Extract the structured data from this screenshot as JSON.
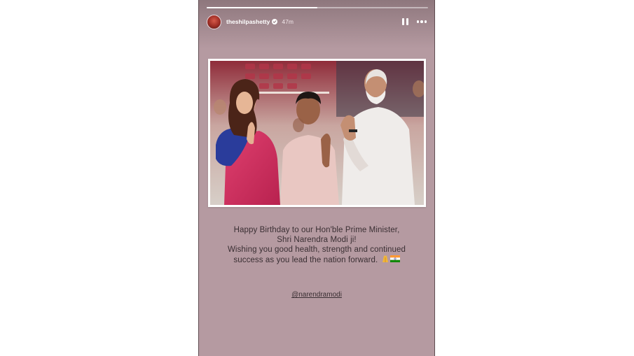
{
  "story": {
    "progress": 0.5,
    "username": "theshilpashetty",
    "verified": true,
    "time_ago": "47m",
    "caption": {
      "line1": "Happy Birthday to our Hon'ble Prime Minister,",
      "line2": "Shri Narendra Modi ji!",
      "line3": "Wishing you good health, strength and continued",
      "line4": "success as you lead the nation forward."
    },
    "mention": "@narendramodi"
  },
  "icons": {
    "pause": "pause-icon",
    "more": "more-options-icon",
    "verified": "verified-badge-icon",
    "emojis": [
      "folded-hands-emoji",
      "india-flag-emoji"
    ]
  },
  "colors": {
    "story_background": "#b59aa1",
    "caption_text": "#3a2f33"
  }
}
